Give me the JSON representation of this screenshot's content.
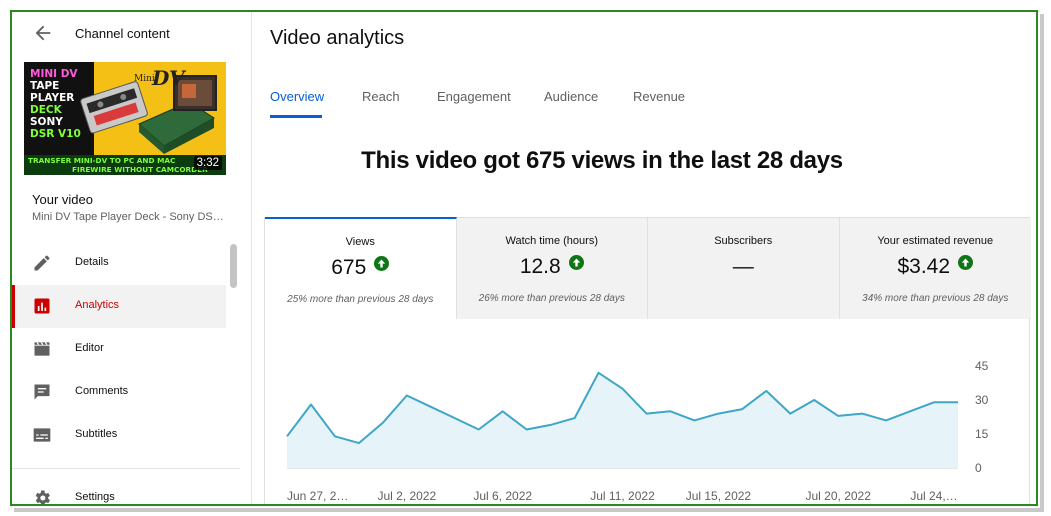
{
  "sidebar": {
    "title": "Channel content",
    "thumbnail": {
      "lines": [
        "MINI DV",
        "TAPE",
        "PLAYER",
        "DECK",
        "SONY",
        "DSR V10"
      ],
      "band_lines": [
        "TRANSFER MINI-DV TO PC AND MAC",
        "FIREWIRE WITHOUT CAMCORDER"
      ],
      "logo_small": "Mini",
      "logo_big": "DV",
      "duration": "3:32"
    },
    "your_video_label": "Your video",
    "video_title": "Mini DV Tape Player Deck - Sony DS…",
    "nav": [
      {
        "label": "Details",
        "icon": "pencil-icon"
      },
      {
        "label": "Analytics",
        "icon": "analytics-icon"
      },
      {
        "label": "Editor",
        "icon": "clapperboard-icon"
      },
      {
        "label": "Comments",
        "icon": "comments-icon"
      },
      {
        "label": "Subtitles",
        "icon": "subtitles-icon"
      }
    ],
    "settings_label": "Settings"
  },
  "main": {
    "title": "Video analytics",
    "tabs": [
      "Overview",
      "Reach",
      "Engagement",
      "Audience",
      "Revenue"
    ],
    "headline": "This video got 675 views in the last 28 days",
    "cards": [
      {
        "label": "Views",
        "value": "675",
        "up": true,
        "sub": "25% more than previous 28 days"
      },
      {
        "label": "Watch time (hours)",
        "value": "12.8",
        "up": true,
        "sub": "26% more than previous 28 days"
      },
      {
        "label": "Subscribers",
        "value": "—",
        "up": false,
        "sub": ""
      },
      {
        "label": "Your estimated revenue",
        "value": "$3.42",
        "up": true,
        "sub": "34% more than previous 28 days"
      }
    ]
  },
  "colors": {
    "accent_blue": "#065fd4",
    "analytics_red": "#cc0000",
    "up_green": "#107516",
    "line": "#3ea6c7",
    "area": "#e6f3f9"
  },
  "chart_data": {
    "type": "area",
    "x": [
      "Jun 27, 2022",
      "Jun 28, 2022",
      "Jun 29, 2022",
      "Jun 30, 2022",
      "Jul 1, 2022",
      "Jul 2, 2022",
      "Jul 3, 2022",
      "Jul 4, 2022",
      "Jul 5, 2022",
      "Jul 6, 2022",
      "Jul 7, 2022",
      "Jul 8, 2022",
      "Jul 9, 2022",
      "Jul 10, 2022",
      "Jul 11, 2022",
      "Jul 12, 2022",
      "Jul 13, 2022",
      "Jul 14, 2022",
      "Jul 15, 2022",
      "Jul 16, 2022",
      "Jul 17, 2022",
      "Jul 18, 2022",
      "Jul 19, 2022",
      "Jul 20, 2022",
      "Jul 21, 2022",
      "Jul 22, 2022",
      "Jul 23, 2022",
      "Jul 24, 2022",
      "Jul 25, 2022"
    ],
    "series": [
      {
        "values": [
          14,
          28,
          14,
          11,
          20,
          32,
          27,
          22,
          17,
          25,
          17,
          19,
          22,
          42,
          35,
          24,
          25,
          21,
          24,
          26,
          34,
          24,
          30,
          23,
          24,
          21,
          25,
          29,
          29
        ]
      }
    ],
    "x_tick_labels": [
      "Jun 27, 2…",
      "Jul 2, 2022",
      "Jul 6, 2022",
      "Jul 11, 2022",
      "Jul 15, 2022",
      "Jul 20, 2022",
      "Jul 24,…"
    ],
    "y_tick_labels": [
      "45",
      "30",
      "15",
      "0"
    ],
    "ylim": [
      0,
      45
    ],
    "grid": false,
    "title": "",
    "xlabel": "",
    "ylabel": ""
  }
}
